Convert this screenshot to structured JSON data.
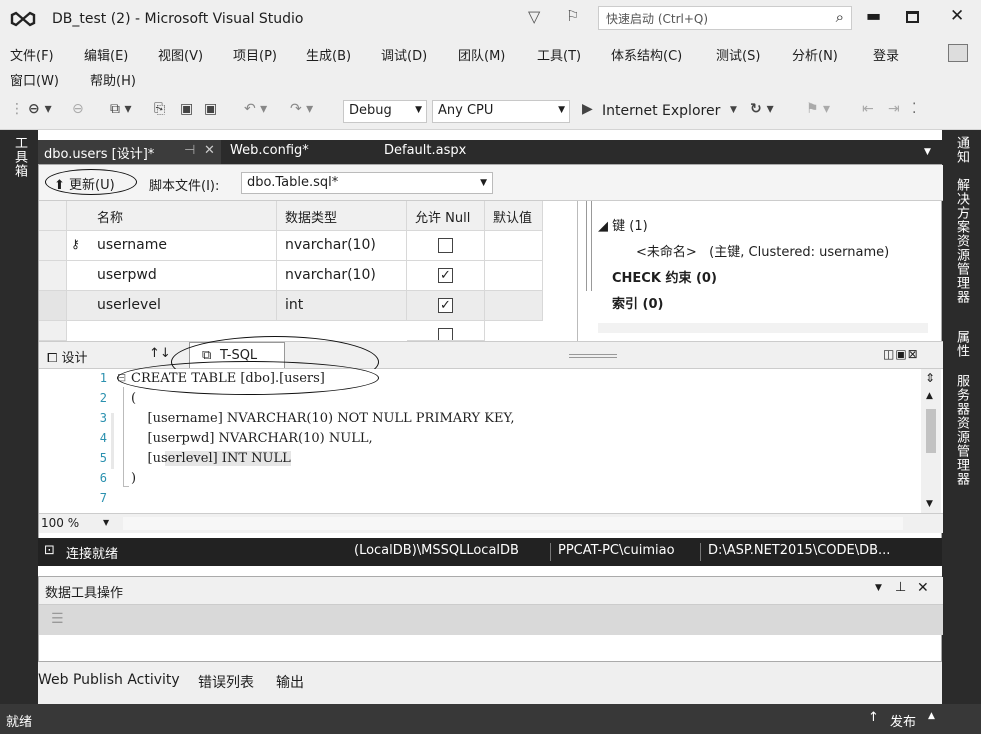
{
  "window": {
    "title": "DB_test (2) - Microsoft Visual Studio",
    "quick_launch_placeholder": "快速启动 (Ctrl+Q)"
  },
  "menu": {
    "row1": [
      "文件(F)",
      "编辑(E)",
      "视图(V)",
      "项目(P)",
      "生成(B)",
      "调试(D)",
      "团队(M)",
      "工具(T)",
      "体系结构(C)",
      "测试(S)",
      "分析(N)"
    ],
    "login": "登录",
    "row2": [
      "窗口(W)",
      "帮助(H)"
    ]
  },
  "toolbar": {
    "config": "Debug",
    "platform": "Any CPU",
    "run_target": "Internet Explorer"
  },
  "side": {
    "left_label": "工具箱",
    "right_labels": [
      "通知",
      "解决方案资源管理器",
      "属性",
      "服务器资源管理器"
    ]
  },
  "doc_tabs": [
    {
      "label": "dbo.users [设计]*",
      "pin": "⊣",
      "close": "✕"
    },
    {
      "label": "Web.config*"
    },
    {
      "label": "Default.aspx"
    }
  ],
  "designer": {
    "update_button": "更新(U)",
    "script_file_label": "脚本文件(I):",
    "script_file_value": "dbo.Table.sql*",
    "grid": {
      "headers": [
        "名称",
        "数据类型",
        "允许 Null",
        "默认值"
      ],
      "rows": [
        {
          "name": "username",
          "type": "nvarchar(10)",
          "allow_null": false,
          "key": true
        },
        {
          "name": "userpwd",
          "type": "nvarchar(10)",
          "allow_null": true,
          "key": false
        },
        {
          "name": "userlevel",
          "type": "int",
          "allow_null": true,
          "key": false
        }
      ]
    },
    "props": {
      "keys_title": "键 (1)",
      "key_entry": "<未命名>   (主键, Clustered: username)",
      "check_title": "CHECK 约束 (0)",
      "index_title": "索引 (0)"
    },
    "split_tabs": {
      "design": "设计",
      "swap": "↑↓",
      "tsql": "T-SQL"
    }
  },
  "editor": {
    "lines": [
      {
        "n": "1",
        "text": "CREATE TABLE [dbo].[users]"
      },
      {
        "n": "2",
        "text": "("
      },
      {
        "n": "3",
        "text": "    [username] NVARCHAR(10) NOT NULL PRIMARY KEY,"
      },
      {
        "n": "4",
        "text": "    [userpwd] NVARCHAR(10) NULL,"
      },
      {
        "n": "5",
        "text": "    [userlevel] INT NULL"
      },
      {
        "n": "6",
        "text": ")"
      },
      {
        "n": "7",
        "text": ""
      }
    ],
    "zoom": "100 %"
  },
  "connection_bar": {
    "status": "连接就绪",
    "server": "(LocalDB)\\MSSQLLocalDB",
    "user": "PPCAT-PC\\cuimiao",
    "path": "D:\\ASP.NET2015\\CODE\\DB..."
  },
  "data_tools": {
    "title": "数据工具操作"
  },
  "bottom_tabs": [
    "Web Publish Activity",
    "错误列表",
    "输出"
  ],
  "status_bar": {
    "left": "就绪",
    "publish": "发布"
  }
}
